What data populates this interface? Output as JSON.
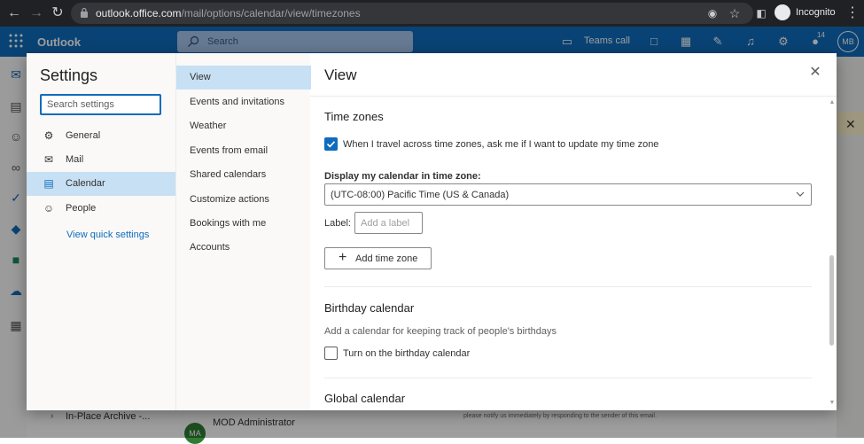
{
  "browser": {
    "url_host": "outlook.office.com",
    "url_path": "/mail/options/calendar/view/timezones",
    "profile_label": "Incognito"
  },
  "topbar": {
    "app_name": "Outlook",
    "search_placeholder": "Search",
    "teams_call": "Teams call",
    "tips_badge": "14",
    "avatar_initials": "MB"
  },
  "background": {
    "archive_folder": "In-Place Archive -...",
    "sender": "MOD Administrator",
    "sender_initials": "MA",
    "notice": "please notify us immediately by responding to the sender of this email."
  },
  "settings": {
    "title": "Settings",
    "search_placeholder": "Search settings",
    "categories": [
      {
        "label": "General",
        "icon": "gear-icon"
      },
      {
        "label": "Mail",
        "icon": "mail-icon"
      },
      {
        "label": "Calendar",
        "icon": "calendar-icon",
        "selected": true
      },
      {
        "label": "People",
        "icon": "people-icon"
      }
    ],
    "quick_settings_link": "View quick settings",
    "subnav": [
      {
        "label": "View",
        "selected": true
      },
      {
        "label": "Events and invitations"
      },
      {
        "label": "Weather"
      },
      {
        "label": "Events from email"
      },
      {
        "label": "Shared calendars"
      },
      {
        "label": "Customize actions"
      },
      {
        "label": "Bookings with me"
      },
      {
        "label": "Accounts"
      }
    ]
  },
  "view": {
    "title": "View",
    "time_zones": {
      "heading": "Time zones",
      "travel_prompt_label": "When I travel across time zones, ask me if I want to update my time zone",
      "travel_prompt_checked": true,
      "display_label": "Display my calendar in time zone:",
      "selected_time_zone": "(UTC-08:00) Pacific Time (US & Canada)",
      "label_field_label": "Label:",
      "label_field_placeholder": "Add a label",
      "add_button": "Add time zone"
    },
    "birthday_calendar": {
      "heading": "Birthday calendar",
      "description": "Add a calendar for keeping track of people's birthdays",
      "toggle_label": "Turn on the birthday calendar",
      "checked": false
    },
    "global_calendar": {
      "heading": "Global calendar"
    }
  },
  "colors": {
    "accent": "#0f6cbd",
    "selected_nav": "#c7e0f4",
    "browser_chrome": "#202124"
  }
}
